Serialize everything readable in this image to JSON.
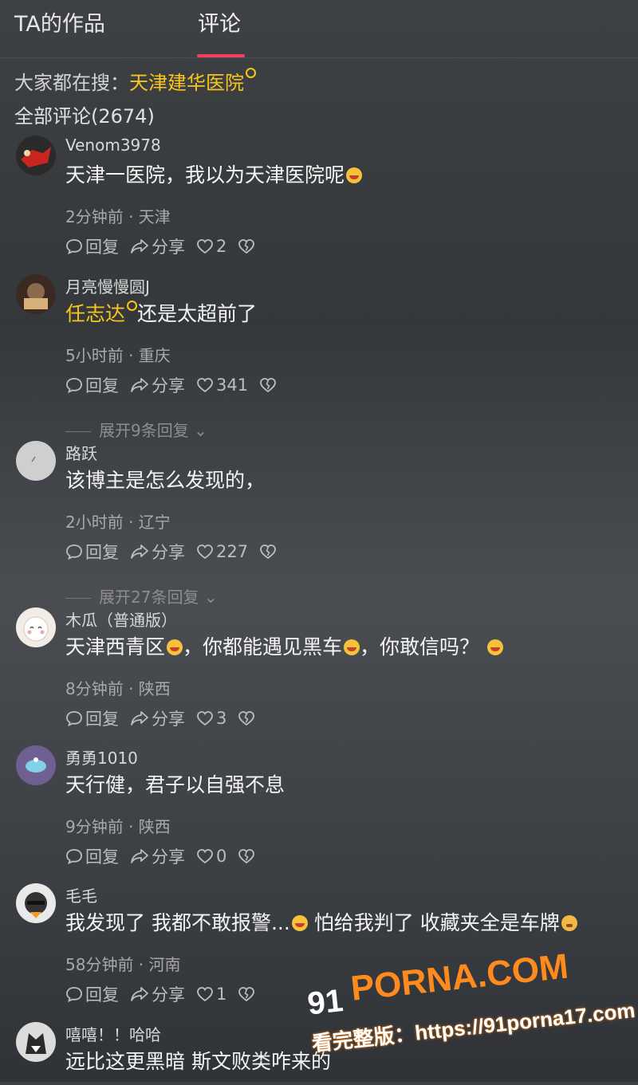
{
  "tabs": {
    "works": "TA的作品",
    "comments": "评论"
  },
  "hot_search": {
    "prefix": "大家都在搜：",
    "term": "天津建华医院"
  },
  "comment_count": "全部评论(2674)",
  "actions": {
    "reply": "回复",
    "share": "分享"
  },
  "comments": [
    {
      "username": "Venom3978",
      "text": "天津一医院，我以为天津医院呢",
      "meta": "2分钟前 · 天津",
      "likes": "2",
      "expand": ""
    },
    {
      "username": "月亮慢慢圆J",
      "keyword": "任志达",
      "text": "还是太超前了",
      "meta": "5小时前 · 重庆",
      "likes": "341",
      "expand": "展开9条回复"
    },
    {
      "username": "路跃",
      "text": "该博主是怎么发现的，",
      "meta": "2小时前 · 辽宁",
      "likes": "227",
      "expand": "展开27条回复"
    },
    {
      "username": "木瓜（普通版）",
      "text_parts": [
        "天津西青区",
        "，你都能遇见黑车",
        "，你敢信吗？"
      ],
      "meta": "8分钟前 · 陕西",
      "likes": "3",
      "expand": ""
    },
    {
      "username": "勇勇1010",
      "text": "天行健，君子以自强不息",
      "meta": "9分钟前 · 陕西",
      "likes": "0",
      "expand": ""
    },
    {
      "username": "毛毛",
      "text_parts": [
        "我发现了 我都不敢报警...",
        " 怕给我判了 收藏夹全是车牌"
      ],
      "meta": "58分钟前 · 河南",
      "likes": "1",
      "expand": ""
    },
    {
      "username": "嘻嘻！！哈哈",
      "text": "远比这更黑暗 斯文败类咋来的"
    }
  ],
  "watermark": {
    "brand": "PORNA.COM",
    "prefix": "91",
    "url_line": "看完整版：https://91porna17.com"
  },
  "colors": {
    "accent": "#ff3b5c",
    "keyword": "#f7c51c",
    "watermark_orange": "#ff8b1e"
  },
  "icons": [
    "search-mini-icon",
    "comment-icon",
    "share-icon",
    "heart-icon",
    "broken-heart-icon",
    "laugh-cry-emoji",
    "sweat-emoji"
  ]
}
